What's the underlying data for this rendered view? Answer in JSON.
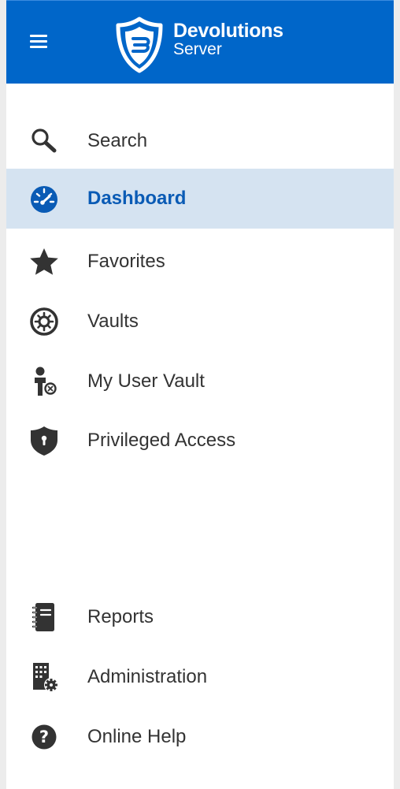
{
  "app": {
    "brand_name": "Devolutions",
    "brand_sub": "Server",
    "accent_color": "#0066c9",
    "active_bg": "#d5e3f1"
  },
  "header": {
    "menu_icon": "hamburger-icon",
    "logo_icon": "devolutions-shield-logo"
  },
  "nav": {
    "primary": [
      {
        "label": "Search",
        "icon": "search-icon",
        "active": false
      },
      {
        "label": "Dashboard",
        "icon": "dashboard-gauge-icon",
        "active": true
      },
      {
        "label": "Favorites",
        "icon": "star-icon",
        "active": false
      },
      {
        "label": "Vaults",
        "icon": "vault-icon",
        "active": false
      },
      {
        "label": "My User Vault",
        "icon": "user-vault-icon",
        "active": false
      },
      {
        "label": "Privileged Access",
        "icon": "shield-lock-icon",
        "active": false
      }
    ],
    "secondary": [
      {
        "label": "Reports",
        "icon": "report-notebook-icon",
        "active": false
      },
      {
        "label": "Administration",
        "icon": "administration-building-gear-icon",
        "active": false
      },
      {
        "label": "Online Help",
        "icon": "help-circle-icon",
        "active": false
      }
    ]
  }
}
